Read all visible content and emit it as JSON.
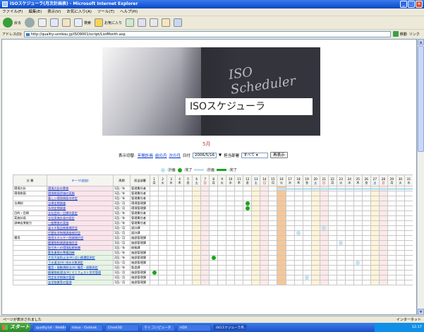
{
  "window": {
    "title": "ISOスケジューラ(月次計画表) - Microsoft Internet Explorer",
    "btn_min": "_",
    "btn_max": "□",
    "btn_close": "×"
  },
  "menu": [
    "ファイル(F)",
    "編集(E)",
    "表示(V)",
    "お気に入り(A)",
    "ツール(T)",
    "ヘルプ(H)"
  ],
  "toolbar": {
    "back": "戻る",
    "search": "検索",
    "favorites": "お気に入り"
  },
  "address": {
    "label": "アドレス(D)",
    "url": "http://quality-unnkou.jp/ISO9001/script/ListMonth.asp",
    "go": "移動",
    "links": "リンク"
  },
  "banner": {
    "logo": "ISO Scheduler",
    "title": "ISOスケジューラ"
  },
  "month_title": "5月",
  "filter": {
    "label_mode": "表示切替:",
    "link_yearly": "年間計画",
    "link_prev": "前の月",
    "link_next": "次の月",
    "label_date": "日付",
    "date_value": "2006/5/16",
    "label_dept": "担当部署",
    "dept_value": "すべて",
    "refresh": "再表示"
  },
  "legend": {
    "planned": ":計画",
    "done": ":完了",
    "plan_bar": ":計画",
    "done_bar": ":完了"
  },
  "table": {
    "headers": {
      "category": "分 類",
      "theme": "テーマ(追加)",
      "period": "周期",
      "dept": "担当部署"
    },
    "days": [
      "1",
      "2",
      "3",
      "4",
      "5",
      "6",
      "7",
      "8",
      "9",
      "10",
      "11",
      "12",
      "13",
      "14",
      "15",
      "16",
      "17",
      "18",
      "19",
      "20",
      "21",
      "22",
      "23",
      "24",
      "25",
      "26",
      "27",
      "28",
      "29",
      "30",
      "31"
    ],
    "weekdays": [
      "月",
      "火",
      "水",
      "木",
      "金",
      "土",
      "日",
      "月",
      "火",
      "水",
      "木",
      "金",
      "土",
      "日",
      "月",
      "火",
      "水",
      "木",
      "金",
      "土",
      "日",
      "月",
      "火",
      "水",
      "木",
      "金",
      "土",
      "日",
      "月",
      "火",
      "水"
    ],
    "rows": [
      {
        "cat": "環境方針",
        "theme": "環境方針の教育",
        "period": "1回／年",
        "dept": "管理責任者",
        "g": false
      },
      {
        "cat": "環境側面",
        "theme": "環境側面評価の実施",
        "period": "1回／年",
        "dept": "管理責任者",
        "g": false
      },
      {
        "cat": "",
        "theme": "著しい環境側面の特定",
        "period": "1回／年",
        "dept": "管理責任者",
        "g": false
      },
      {
        "cat": "法規制",
        "theme": "法律定期調査",
        "period": "1回／月",
        "dept": "環境管理課",
        "g": false
      },
      {
        "cat": "",
        "theme": "条例定期調査",
        "period": "1回／月",
        "dept": "環境管理課",
        "g": false
      },
      {
        "cat": "目的・目標",
        "theme": "全社目的・目標の設定",
        "period": "1回／年",
        "dept": "管理責任者",
        "g": false
      },
      {
        "cat": "実施計画",
        "theme": "全社実施計画の設定",
        "period": "1回／年",
        "dept": "管理責任者",
        "g": false
      },
      {
        "cat": "訓練自覚能力",
        "theme": "一般教育の実施",
        "period": "1回／年",
        "dept": "管理責任者",
        "g": false
      },
      {
        "cat": "",
        "theme": "省エネ製品推進検討会",
        "period": "1回／月",
        "dept": "設計課",
        "g": false
      },
      {
        "cat": "",
        "theme": "代替化学物質調査検討会",
        "period": "1回／月",
        "dept": "設計課",
        "g": false
      },
      {
        "cat": "運用",
        "theme": "使用エネルギー削減検討会",
        "period": "1回／月",
        "dept": "施設管理課",
        "g": false
      },
      {
        "cat": "",
        "theme": "廃棄物削減調査検討会",
        "period": "1回／月",
        "dept": "施設管理課",
        "g": false
      },
      {
        "cat": "",
        "theme": "取引先への環境配慮依頼",
        "period": "1回／年",
        "dept": "総務課",
        "g": false
      },
      {
        "cat": "",
        "theme": "緊急事態の準備訓練",
        "period": "1回／年",
        "dept": "施設管理課",
        "g": true
      },
      {
        "cat": "",
        "theme": "大気汚染防止法(※)  ばい煙濃度測定",
        "period": "2回／年",
        "dept": "施設管理課",
        "g": true
      },
      {
        "cat": "",
        "theme": "下水道法(※)  排水水質測定",
        "period": "1回／月",
        "dept": "施設管理課",
        "g": true
      },
      {
        "cat": "",
        "theme": "騒音・振動規制法(※)  騒音・振動測定",
        "period": "1回／年",
        "dept": "製造課",
        "g": true
      },
      {
        "cat": "",
        "theme": "廃棄物処理法(※)  マニフェスト交付管理",
        "period": "1回／月",
        "dept": "施設管理課",
        "g": true
      },
      {
        "cat": "",
        "theme": "特定化学物質の管理",
        "period": "1回／月",
        "dept": "施設管理課",
        "g": true
      },
      {
        "cat": "",
        "theme": "化学物質等の管理",
        "period": "1回／月",
        "dept": "施設管理課",
        "g": true
      }
    ]
  },
  "status": {
    "left": "ページが表示されました",
    "zone": "インターネット"
  },
  "taskbar": {
    "start": "スタート",
    "items": [
      "quality.txt - WebBrit",
      "Inbox - Outlook",
      "Cheet3D",
      "マイ コンピュータ",
      "HDX",
      "ISOスケジューラ月..."
    ],
    "clock": "12:17"
  },
  "colors": {
    "plan": "#bde3f3",
    "done": "#19a51a",
    "today": "#f6c796"
  }
}
